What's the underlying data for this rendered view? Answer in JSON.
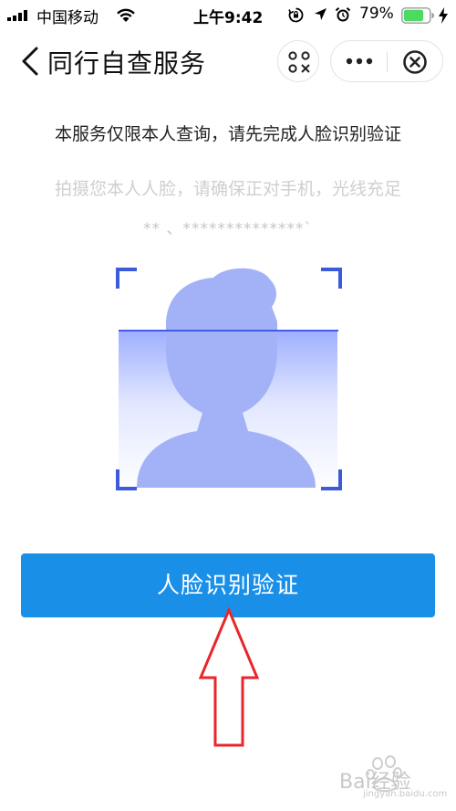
{
  "status_bar": {
    "carrier": "中国移动",
    "time": "上午9:42",
    "battery_percent": "79%",
    "battery_level": 0.79,
    "icons": [
      "signal-icon",
      "wifi-icon",
      "rotation-lock-icon",
      "location-icon",
      "alarm-icon",
      "battery-icon",
      "charging-icon"
    ]
  },
  "nav": {
    "title": "同行自查服务",
    "icons": [
      "back-chevron-icon",
      "scan-icon",
      "more-dots-icon",
      "close-circle-icon"
    ]
  },
  "content": {
    "notice": "本服务仅限本人查询，请先完成人脸识别验证",
    "hint": "拍摄您本人人脸，请确保正对手机，光线充足",
    "masked_info": "**  、**************`"
  },
  "face": {
    "icons": [
      "face-frame-icon",
      "person-silhouette-icon"
    ]
  },
  "action": {
    "verify_label": "人脸识别验证"
  },
  "annotation": {
    "arrow_color": "#e8262b",
    "icons": [
      "up-arrow-annotation-icon"
    ]
  },
  "watermark": {
    "text": "Bai经验",
    "sub": "jingyan.baidu.com"
  },
  "colors": {
    "primary": "#1a8fe8",
    "frame_corner": "#3b5bd9",
    "silhouette": "#a3b2f7",
    "scan_line": "#4359e8"
  }
}
